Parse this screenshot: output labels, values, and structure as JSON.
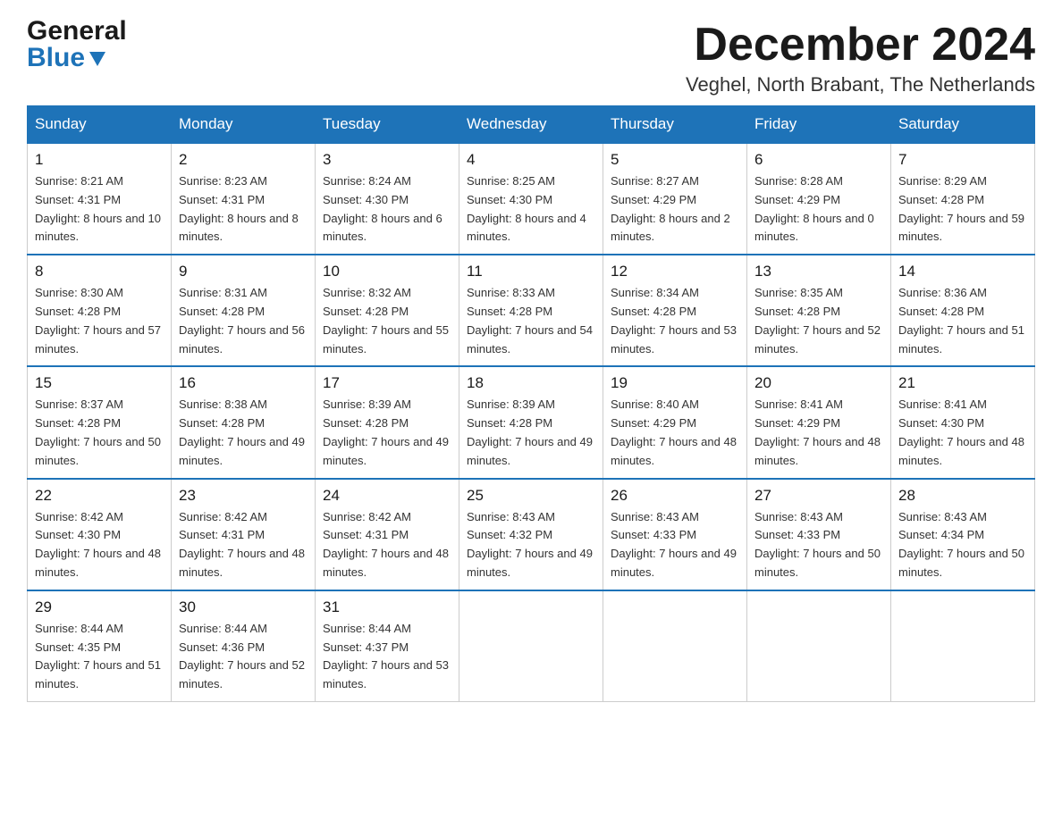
{
  "header": {
    "logo_line1": "General",
    "logo_line2": "Blue",
    "month_title": "December 2024",
    "location": "Veghel, North Brabant, The Netherlands"
  },
  "days_of_week": [
    "Sunday",
    "Monday",
    "Tuesday",
    "Wednesday",
    "Thursday",
    "Friday",
    "Saturday"
  ],
  "weeks": [
    [
      {
        "day": 1,
        "sunrise": "8:21 AM",
        "sunset": "4:31 PM",
        "daylight": "8 hours and 10 minutes"
      },
      {
        "day": 2,
        "sunrise": "8:23 AM",
        "sunset": "4:31 PM",
        "daylight": "8 hours and 8 minutes"
      },
      {
        "day": 3,
        "sunrise": "8:24 AM",
        "sunset": "4:30 PM",
        "daylight": "8 hours and 6 minutes"
      },
      {
        "day": 4,
        "sunrise": "8:25 AM",
        "sunset": "4:30 PM",
        "daylight": "8 hours and 4 minutes"
      },
      {
        "day": 5,
        "sunrise": "8:27 AM",
        "sunset": "4:29 PM",
        "daylight": "8 hours and 2 minutes"
      },
      {
        "day": 6,
        "sunrise": "8:28 AM",
        "sunset": "4:29 PM",
        "daylight": "8 hours and 0 minutes"
      },
      {
        "day": 7,
        "sunrise": "8:29 AM",
        "sunset": "4:28 PM",
        "daylight": "7 hours and 59 minutes"
      }
    ],
    [
      {
        "day": 8,
        "sunrise": "8:30 AM",
        "sunset": "4:28 PM",
        "daylight": "7 hours and 57 minutes"
      },
      {
        "day": 9,
        "sunrise": "8:31 AM",
        "sunset": "4:28 PM",
        "daylight": "7 hours and 56 minutes"
      },
      {
        "day": 10,
        "sunrise": "8:32 AM",
        "sunset": "4:28 PM",
        "daylight": "7 hours and 55 minutes"
      },
      {
        "day": 11,
        "sunrise": "8:33 AM",
        "sunset": "4:28 PM",
        "daylight": "7 hours and 54 minutes"
      },
      {
        "day": 12,
        "sunrise": "8:34 AM",
        "sunset": "4:28 PM",
        "daylight": "7 hours and 53 minutes"
      },
      {
        "day": 13,
        "sunrise": "8:35 AM",
        "sunset": "4:28 PM",
        "daylight": "7 hours and 52 minutes"
      },
      {
        "day": 14,
        "sunrise": "8:36 AM",
        "sunset": "4:28 PM",
        "daylight": "7 hours and 51 minutes"
      }
    ],
    [
      {
        "day": 15,
        "sunrise": "8:37 AM",
        "sunset": "4:28 PM",
        "daylight": "7 hours and 50 minutes"
      },
      {
        "day": 16,
        "sunrise": "8:38 AM",
        "sunset": "4:28 PM",
        "daylight": "7 hours and 49 minutes"
      },
      {
        "day": 17,
        "sunrise": "8:39 AM",
        "sunset": "4:28 PM",
        "daylight": "7 hours and 49 minutes"
      },
      {
        "day": 18,
        "sunrise": "8:39 AM",
        "sunset": "4:28 PM",
        "daylight": "7 hours and 49 minutes"
      },
      {
        "day": 19,
        "sunrise": "8:40 AM",
        "sunset": "4:29 PM",
        "daylight": "7 hours and 48 minutes"
      },
      {
        "day": 20,
        "sunrise": "8:41 AM",
        "sunset": "4:29 PM",
        "daylight": "7 hours and 48 minutes"
      },
      {
        "day": 21,
        "sunrise": "8:41 AM",
        "sunset": "4:30 PM",
        "daylight": "7 hours and 48 minutes"
      }
    ],
    [
      {
        "day": 22,
        "sunrise": "8:42 AM",
        "sunset": "4:30 PM",
        "daylight": "7 hours and 48 minutes"
      },
      {
        "day": 23,
        "sunrise": "8:42 AM",
        "sunset": "4:31 PM",
        "daylight": "7 hours and 48 minutes"
      },
      {
        "day": 24,
        "sunrise": "8:42 AM",
        "sunset": "4:31 PM",
        "daylight": "7 hours and 48 minutes"
      },
      {
        "day": 25,
        "sunrise": "8:43 AM",
        "sunset": "4:32 PM",
        "daylight": "7 hours and 49 minutes"
      },
      {
        "day": 26,
        "sunrise": "8:43 AM",
        "sunset": "4:33 PM",
        "daylight": "7 hours and 49 minutes"
      },
      {
        "day": 27,
        "sunrise": "8:43 AM",
        "sunset": "4:33 PM",
        "daylight": "7 hours and 50 minutes"
      },
      {
        "day": 28,
        "sunrise": "8:43 AM",
        "sunset": "4:34 PM",
        "daylight": "7 hours and 50 minutes"
      }
    ],
    [
      {
        "day": 29,
        "sunrise": "8:44 AM",
        "sunset": "4:35 PM",
        "daylight": "7 hours and 51 minutes"
      },
      {
        "day": 30,
        "sunrise": "8:44 AM",
        "sunset": "4:36 PM",
        "daylight": "7 hours and 52 minutes"
      },
      {
        "day": 31,
        "sunrise": "8:44 AM",
        "sunset": "4:37 PM",
        "daylight": "7 hours and 53 minutes"
      },
      null,
      null,
      null,
      null
    ]
  ]
}
